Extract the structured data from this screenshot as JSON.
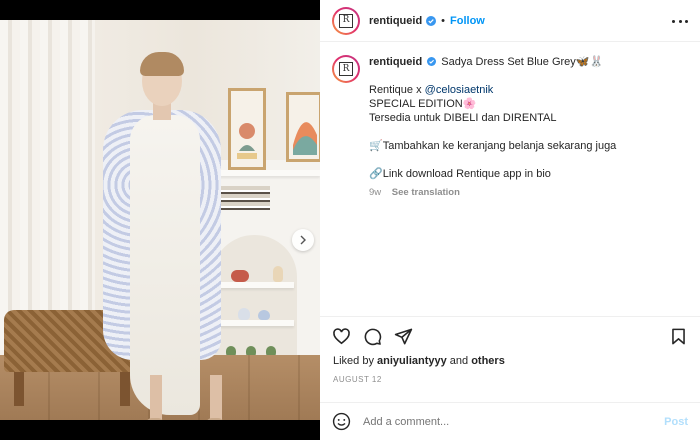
{
  "post": {
    "username": "rentiqueid",
    "follow_label": "Follow",
    "dot": "•",
    "caption": {
      "user": "rentiqueid",
      "title": "Sadya Dress Set Blue Grey🦋🐰",
      "line_collab_prefix": "Rentique x ",
      "line_collab_mention": "@celosiaetnik",
      "line_special": "SPECIAL EDITION🌸",
      "line_available": "Tersedia untuk DIBELI dan DIRENTAL",
      "line_cart": "🛒Tambahkan ke keranjang belanja sekarang juga",
      "line_link": "🔗Link download Rentique app in bio",
      "time_ago": "9w",
      "see_translation": "See translation"
    },
    "likes": {
      "prefix": "Liked by ",
      "user": "aniyuliantyyy",
      "middle": " and ",
      "others": "others"
    },
    "date": "AUGUST 12",
    "comment": {
      "placeholder": "Add a comment...",
      "post_label": "Post"
    },
    "carousel": {
      "slide_count": 3,
      "active_index": 0
    }
  },
  "icons": {
    "verified": "verified-badge-icon",
    "more": "more-options-icon",
    "like": "heart-icon",
    "comment": "comment-bubble-icon",
    "share": "paper-plane-icon",
    "save": "bookmark-icon",
    "emoji": "emoji-smile-icon",
    "next": "chevron-right-icon"
  },
  "colors": {
    "link_blue": "#0095f6",
    "mention": "#00376b",
    "muted": "#8e8e8e",
    "post_disabled": "#b2dffc"
  }
}
